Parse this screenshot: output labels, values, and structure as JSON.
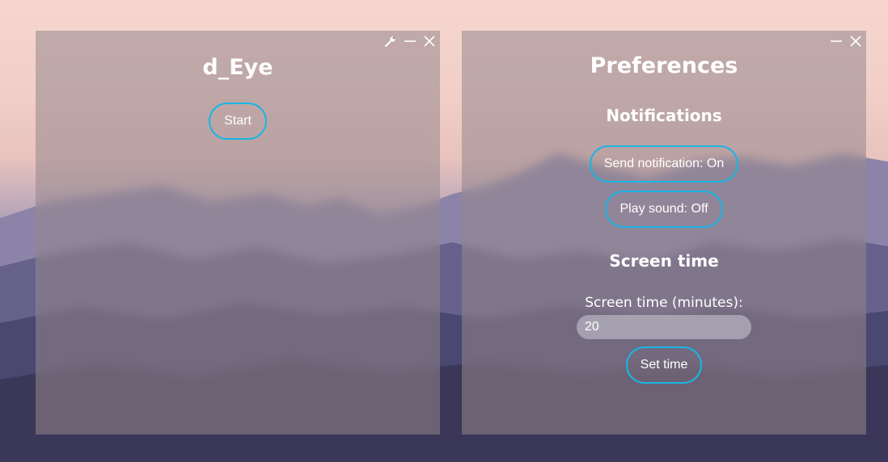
{
  "main_window": {
    "title": "d_Eye",
    "start_label": "Start",
    "controls": [
      "wrench-icon",
      "minimize-icon",
      "close-icon"
    ]
  },
  "prefs_window": {
    "title": "Preferences",
    "notifications_heading": "Notifications",
    "send_notification_label": "Send notification: On",
    "play_sound_label": "Play sound: Off",
    "screen_time_heading": "Screen time",
    "screen_time_field_label": "Screen time (minutes):",
    "screen_time_value": "20",
    "set_time_label": "Set time",
    "controls": [
      "minimize-icon",
      "close-icon"
    ]
  },
  "colors": {
    "accent": "#17b6e6",
    "panel": "rgba(150,135,140,0.55)"
  }
}
